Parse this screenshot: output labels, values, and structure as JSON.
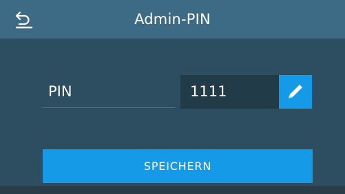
{
  "header": {
    "title": "Admin-PIN",
    "back_icon": "undo-arrow-icon"
  },
  "form": {
    "pin_label": "PIN",
    "pin_value": "1111",
    "edit_icon": "pencil-icon"
  },
  "actions": {
    "save_label": "SPEICHERN"
  },
  "colors": {
    "background": "#2d4e61",
    "header": "#3d6a84",
    "field": "#213b49",
    "accent": "#149ae6",
    "bottom_strip": "#2a3c47"
  }
}
